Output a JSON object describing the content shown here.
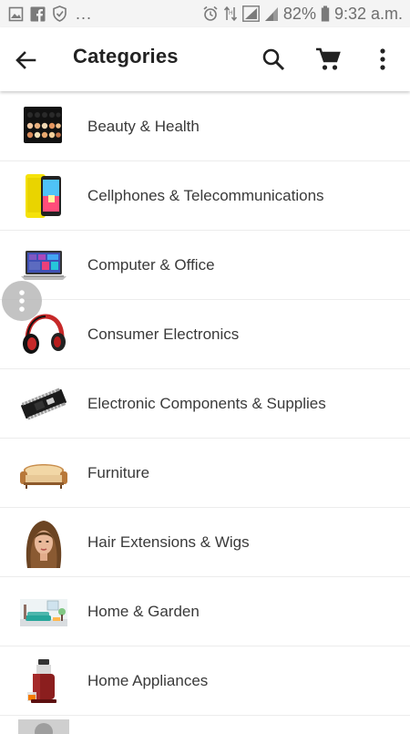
{
  "status_bar": {
    "battery_percent": "82%",
    "time": "9:32 a.m.",
    "notification_more": "..."
  },
  "app_bar": {
    "title": "Categories"
  },
  "categories": [
    {
      "label": "Beauty & Health",
      "icon": "makeup-palette-thumbnail"
    },
    {
      "label": "Cellphones & Telecommunications",
      "icon": "smartphone-thumbnail"
    },
    {
      "label": "Computer & Office",
      "icon": "laptop-thumbnail"
    },
    {
      "label": "Consumer Electronics",
      "icon": "headphones-thumbnail"
    },
    {
      "label": "Electronic Components & Supplies",
      "icon": "circuit-board-thumbnail"
    },
    {
      "label": "Furniture",
      "icon": "sofa-thumbnail"
    },
    {
      "label": "Hair Extensions & Wigs",
      "icon": "woman-hair-thumbnail"
    },
    {
      "label": "Home & Garden",
      "icon": "living-room-thumbnail"
    },
    {
      "label": "Home Appliances",
      "icon": "juicer-thumbnail"
    }
  ],
  "colors": {
    "status_bar_bg": "#f4f4f4",
    "app_bar_bg": "#ffffff",
    "text_primary": "#222222",
    "divider": "#ececec"
  }
}
